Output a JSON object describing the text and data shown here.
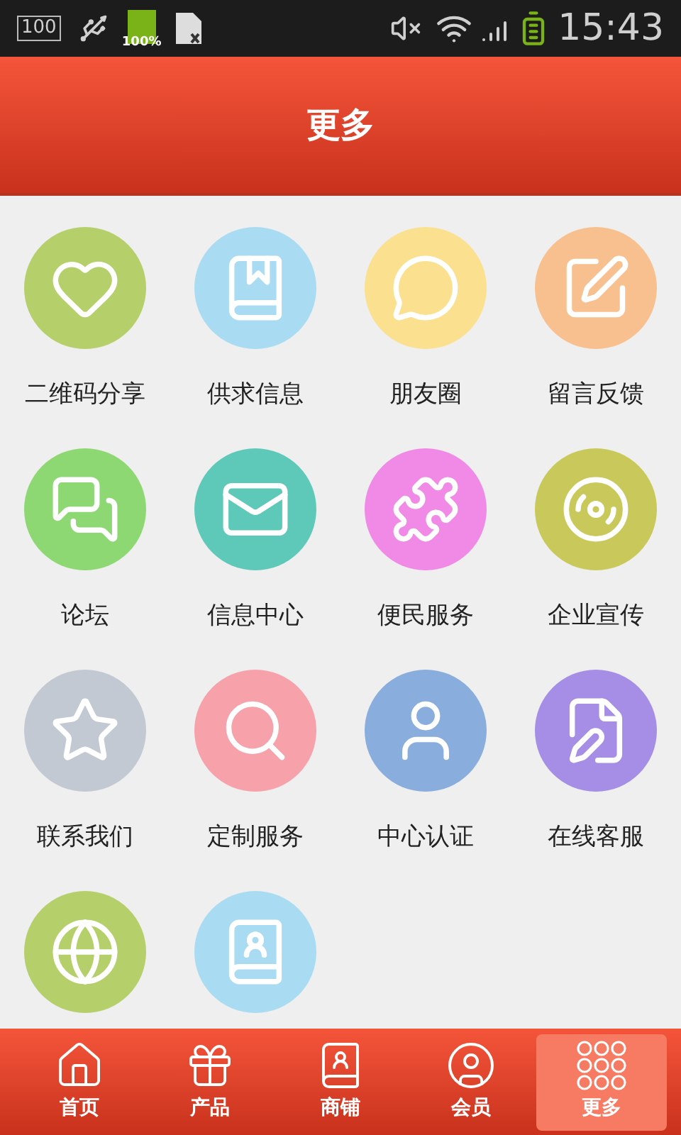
{
  "status_bar": {
    "storage": "100",
    "battery_badge": "100%",
    "time": "15:43"
  },
  "header": {
    "title": "更多"
  },
  "grid": [
    {
      "label": "二维码分享",
      "color": "#b5cf6a"
    },
    {
      "label": "供求信息",
      "color": "#a9dcf2"
    },
    {
      "label": "朋友圈",
      "color": "#fbe08f"
    },
    {
      "label": "留言反馈",
      "color": "#f8c08f"
    },
    {
      "label": "论坛",
      "color": "#8ed874"
    },
    {
      "label": "信息中心",
      "color": "#5ec9b8"
    },
    {
      "label": "便民服务",
      "color": "#f08ae6"
    },
    {
      "label": "企业宣传",
      "color": "#c9c85a"
    },
    {
      "label": "联系我们",
      "color": "#c3c9d3"
    },
    {
      "label": "定制服务",
      "color": "#f7a1ab"
    },
    {
      "label": "中心认证",
      "color": "#89aede"
    },
    {
      "label": "在线客服",
      "color": "#a68ee6"
    },
    {
      "color": "#b5cf6a"
    },
    {
      "color": "#a9dcf2"
    }
  ],
  "tabs": [
    {
      "label": "首页",
      "selected": false
    },
    {
      "label": "产品",
      "selected": false
    },
    {
      "label": "商铺",
      "selected": false
    },
    {
      "label": "会员",
      "selected": false
    },
    {
      "label": "更多",
      "selected": true
    }
  ]
}
